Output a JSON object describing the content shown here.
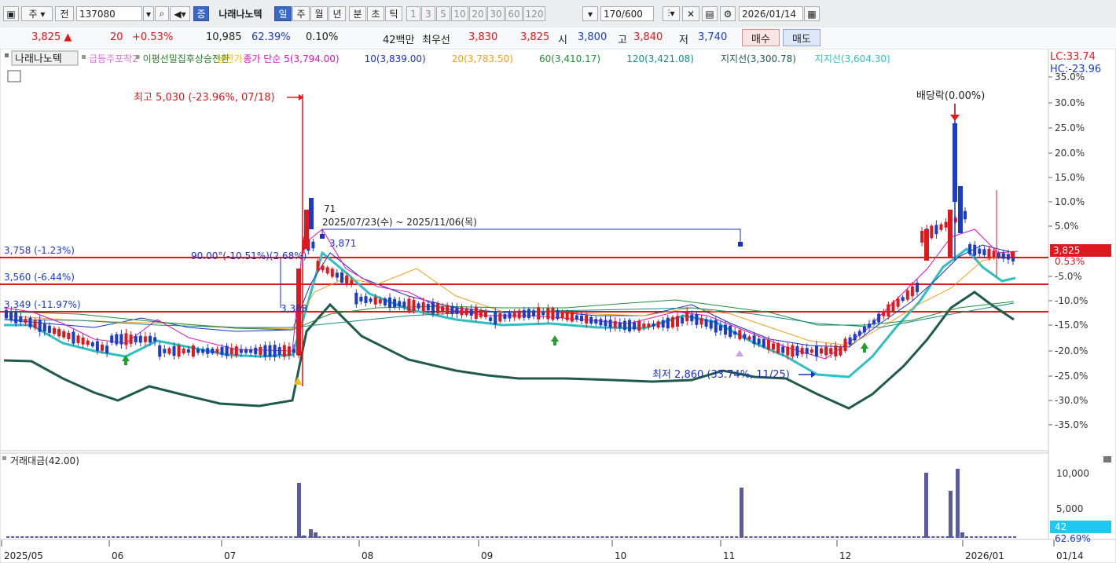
{
  "toolbar": {
    "market": "주",
    "prev": "전",
    "code": "137080",
    "badge": "증",
    "name": "나래나노텍",
    "periods": [
      "일",
      "주",
      "월",
      "년",
      "분",
      "초",
      "틱"
    ],
    "minutes": [
      "1",
      "3",
      "5",
      "10",
      "20",
      "30",
      "60",
      "120"
    ],
    "count": "170",
    "total": "/600",
    "date": "2026/01/14"
  },
  "quote": {
    "price": "3,825 ▲",
    "change": "20",
    "pct": "+0.53%",
    "volume": "10,985",
    "vol_ratio": "62.39%",
    "turnover": "0.10%",
    "amount": "42백만",
    "best_ask_label": "최우선",
    "ask": "3,830",
    "bid": "3,825",
    "open_label": "시",
    "open": "3,800",
    "high_label": "고",
    "high": "3,840",
    "low_label": "저",
    "low": "3,740",
    "buy": "매수",
    "sell": "매도"
  },
  "legend": [
    {
      "text": "나래나노텍",
      "color": "#222222"
    },
    {
      "text": "급등주포착2",
      "color": "#e070e0"
    },
    {
      "text": "이평선밀집후상승전환",
      "color": "#2a7a2a"
    },
    {
      "text": "상한가",
      "color": "#f0c000"
    },
    {
      "text": "종가 단순 5(3,794.00)",
      "color": "#e010c0"
    },
    {
      "text": "10(3,839.00)",
      "color": "#1a2fc8"
    },
    {
      "text": "20(3,783.50)",
      "color": "#f0a020"
    },
    {
      "text": "60(3,410.17)",
      "color": "#1f8f3a"
    },
    {
      "text": "120(3,421.08)",
      "color": "#158a8a"
    },
    {
      "text": "지지선(3,300.78)",
      "color": "#1f5a4a"
    },
    {
      "text": "지지선(3,604.30)",
      "color": "#2ec0c0"
    }
  ],
  "lc": "LC:33.74",
  "hc": "HC:-23.96",
  "axis_pct": [
    "35.0%",
    "30.0%",
    "25.0%",
    "20.0%",
    "15.0%",
    "10.0%",
    "5.0%",
    "0.53%",
    "-5.0%",
    "-10.0%",
    "-15.0%",
    "-20.0%",
    "-25.0%",
    "-30.0%",
    "-35.0%"
  ],
  "axis_vol": [
    "10,000",
    "5,000"
  ],
  "price_tag": "3,825",
  "vol_tag": "42",
  "vol_pct": "62.69%",
  "dates": [
    "2025/05",
    "06",
    "07",
    "08",
    "09",
    "10",
    "11",
    "12",
    "2026/01",
    "01/14"
  ],
  "annotations": {
    "high": "최고 5,030 (-23.96%, 07/18)",
    "low": "최저 2,860 (33.74%, 11/25)",
    "dividend": "배당락(0.00%)",
    "range": "2025/07/23(수) ~ 2025/11/06(목)",
    "n71": "71",
    "n3871": "3,871",
    "n3368": "3,368",
    "fib": "90.00°(-10.51%)(2.68%)"
  },
  "hlines": [
    "3,758 (-1.23%)",
    "3,560 (-6.44%)",
    "3,349 (-11.97%)"
  ],
  "volume_panel_title": "거래대금(42.00)",
  "colors": {
    "up": "#e0171c",
    "down": "#1a3cc8",
    "hline": "#e0171c"
  }
}
